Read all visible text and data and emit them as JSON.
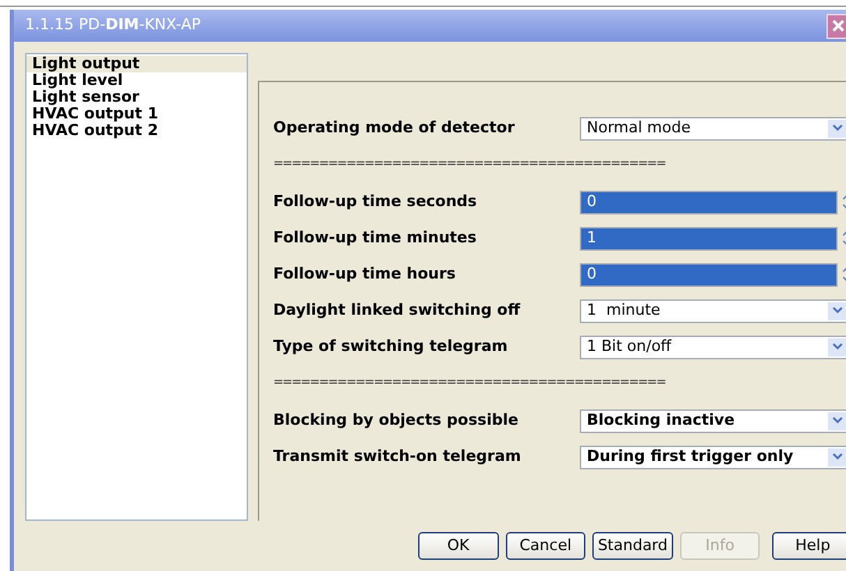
{
  "window": {
    "title": "1.1.15 PD-**DIM**-KNX-AP"
  },
  "sidebar": {
    "items": [
      {
        "label": "Light output",
        "selected": true
      },
      {
        "label": "Light level",
        "selected": false
      },
      {
        "label": "Light sensor",
        "selected": false
      },
      {
        "label": "HVAC output 1",
        "selected": false
      },
      {
        "label": "HVAC output 2",
        "selected": false
      }
    ]
  },
  "parameters": [
    {
      "kind": "dropdown",
      "label": "Operating mode of detector",
      "value": "Normal mode",
      "bold": false
    },
    {
      "kind": "separator",
      "text": "==========================================="
    },
    {
      "kind": "spin",
      "label": "Follow-up time seconds",
      "value": "0",
      "selected": true
    },
    {
      "kind": "spin",
      "label": "Follow-up time minutes",
      "value": "1",
      "selected": true
    },
    {
      "kind": "spin",
      "label": "Follow-up time hours",
      "value": "0",
      "selected": true
    },
    {
      "kind": "dropdown",
      "label": "Daylight linked switching off",
      "value": "1  minute",
      "bold": false
    },
    {
      "kind": "dropdown",
      "label": "Type of switching telegram",
      "value": "1 Bit on/off",
      "bold": false
    },
    {
      "kind": "separator",
      "text": "==========================================="
    },
    {
      "kind": "dropdown",
      "label": "Blocking by objects possible",
      "value": "Blocking inactive",
      "bold": true
    },
    {
      "kind": "dropdown",
      "label": "Transmit switch-on telegram",
      "value": "During first trigger only",
      "bold": true
    }
  ],
  "buttons": [
    {
      "label": "OK",
      "disabled": false
    },
    {
      "label": "Cancel",
      "disabled": false
    },
    {
      "label": "Standard",
      "disabled": false
    },
    {
      "label": "Info",
      "disabled": true
    },
    {
      "label": "Help",
      "disabled": false
    }
  ]
}
